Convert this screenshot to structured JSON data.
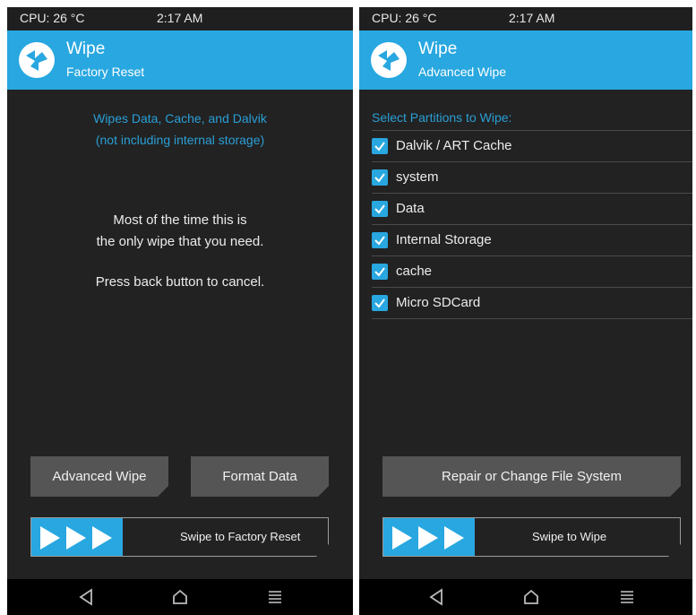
{
  "left": {
    "status": {
      "cpu": "CPU: 26 °C",
      "time": "2:17 AM"
    },
    "header": {
      "title": "Wipe",
      "subtitle": "Factory Reset"
    },
    "info_line1": "Wipes Data, Cache, and Dalvik",
    "info_line2": "(not including internal storage)",
    "message_line1": "Most of the time this is",
    "message_line2": "the only wipe that you need.",
    "message_line3": "Press back button to cancel.",
    "buttons": {
      "advanced": "Advanced Wipe",
      "format": "Format Data"
    },
    "swipe_label": "Swipe to Factory Reset"
  },
  "right": {
    "status": {
      "cpu": "CPU: 26 °C",
      "time": "2:17 AM"
    },
    "header": {
      "title": "Wipe",
      "subtitle": "Advanced Wipe"
    },
    "section_title": "Select Partitions to Wipe:",
    "partitions": [
      {
        "label": "Dalvik / ART Cache",
        "checked": true
      },
      {
        "label": "system",
        "checked": true
      },
      {
        "label": "Data",
        "checked": true
      },
      {
        "label": "Internal Storage",
        "checked": true
      },
      {
        "label": "cache",
        "checked": true
      },
      {
        "label": "Micro SDCard",
        "checked": true
      }
    ],
    "repair_button": "Repair or Change File System",
    "swipe_label": "Swipe to Wipe"
  },
  "icons": {
    "logo": "twrp-logo-icon",
    "back": "back-triangle-icon",
    "home": "home-icon",
    "menu": "menu-lines-icon",
    "arrows": "triple-arrow-icon"
  },
  "colors": {
    "accent": "#28a7e0",
    "background": "#222222",
    "button": "#555555",
    "navbar": "#000000"
  }
}
